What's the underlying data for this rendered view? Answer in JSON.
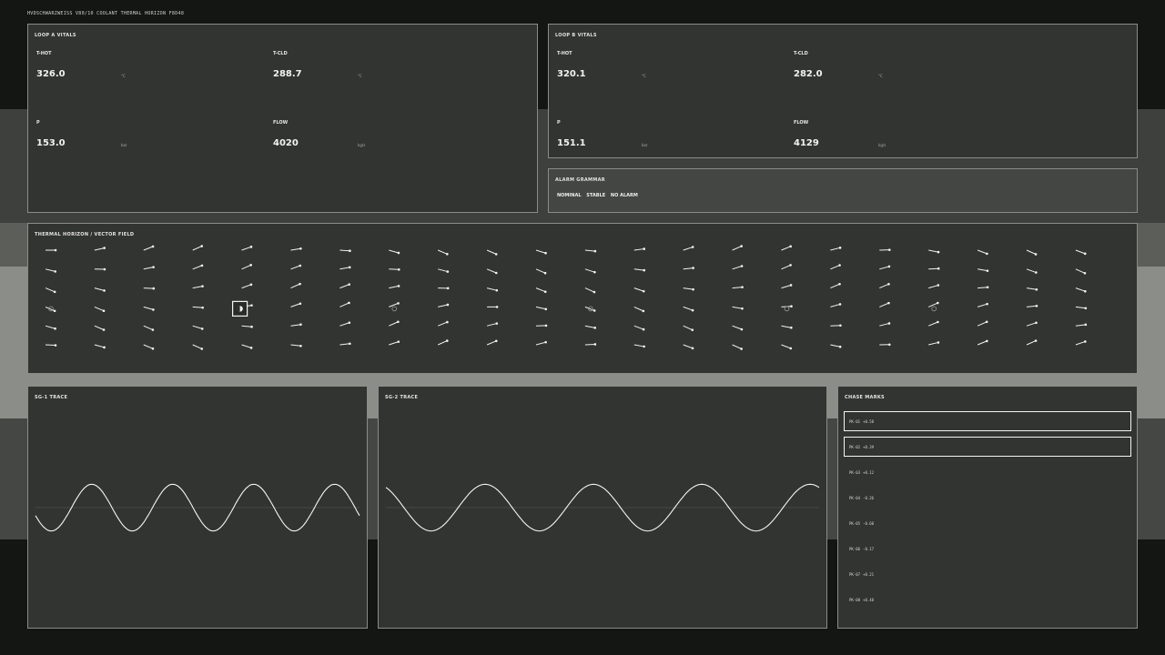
{
  "header": {
    "line": "HVDSCHWARZWEISS  V80/10  COOLANT THERMAL HORIZON  F8D48"
  },
  "loop_a": {
    "title": "LOOP A  VITALS",
    "cells": [
      {
        "label": "T-HOT",
        "value": "326.0",
        "unit": "°C"
      },
      {
        "label": "T-CLD",
        "value": "288.7",
        "unit": "°C"
      },
      {
        "label": "P",
        "value": "153.0",
        "unit": "bar"
      },
      {
        "label": "FLOW",
        "value": "4020",
        "unit": "kg/s"
      }
    ]
  },
  "loop_b": {
    "title": "LOOP B  VITALS",
    "cells": [
      {
        "label": "T-HOT",
        "value": "320.1",
        "unit": "°C"
      },
      {
        "label": "T-CLD",
        "value": "282.0",
        "unit": "°C"
      },
      {
        "label": "P",
        "value": "151.1",
        "unit": "bar"
      },
      {
        "label": "FLOW",
        "value": "4129",
        "unit": "kg/s"
      }
    ]
  },
  "alarm": {
    "title": "ALARM GRAMMAR",
    "words": [
      "NOMINAL",
      "STABLE",
      "NO ALARM"
    ]
  },
  "field": {
    "title": "THERMAL HORIZON / VECTOR FIELD",
    "cols": 22,
    "rows": 6,
    "cursor": {
      "col": 4,
      "row": 3
    },
    "probes_at_row": 3,
    "probe_cols": [
      0,
      7,
      11,
      15,
      18
    ],
    "colors": {
      "arrow": "#f2f2ee",
      "probe": "#9a9c97"
    }
  },
  "sg1": {
    "title": "SG-1 TRACE",
    "cycles": 4,
    "phase_deg": 200,
    "amplitude_frac": 0.95,
    "color": "#f4f4f0"
  },
  "sg2": {
    "title": "SG-2 TRACE",
    "cycles": 4,
    "phase_deg": 120,
    "amplitude_frac": 0.95,
    "color": "#f4f4f0"
  },
  "chase": {
    "title": "CHASE MARKS",
    "marks": [
      {
        "id": "PK-01",
        "delta": "+0.58",
        "selected": true
      },
      {
        "id": "PK-02",
        "delta": "+0.39",
        "selected": true
      },
      {
        "id": "PK-03",
        "delta": "+0.12",
        "selected": false
      },
      {
        "id": "PK-04",
        "delta": "-0.26",
        "selected": false
      },
      {
        "id": "PK-05",
        "delta": "-0.60",
        "selected": false
      },
      {
        "id": "PK-06",
        "delta": "-0.17",
        "selected": false
      },
      {
        "id": "PK-07",
        "delta": "+0.21",
        "selected": false
      },
      {
        "id": "PK-08",
        "delta": "+0.48",
        "selected": false
      }
    ]
  }
}
